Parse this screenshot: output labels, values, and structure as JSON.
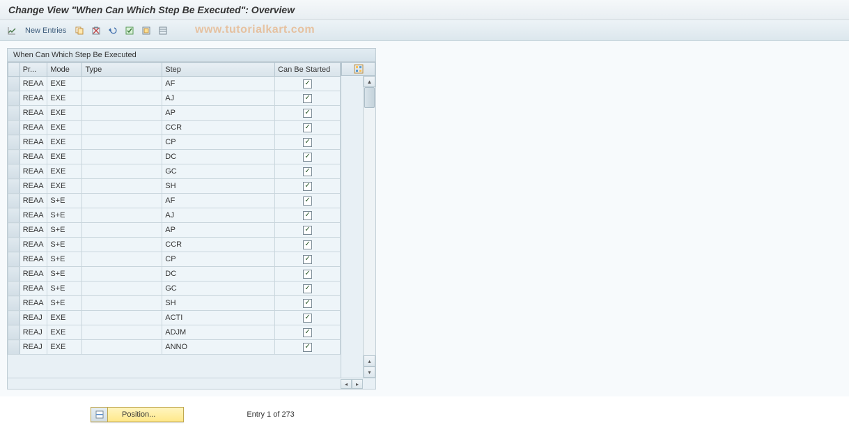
{
  "title": "Change View \"When Can Which Step Be Executed\": Overview",
  "toolbar": {
    "new_entries_label": "New Entries"
  },
  "watermark": "www.tutorialkart.com",
  "panel": {
    "header": "When Can Which Step Be Executed",
    "columns": {
      "pr": "Pr...",
      "mode": "Mode",
      "type": "Type",
      "step": "Step",
      "started": "Can Be Started"
    },
    "rows": [
      {
        "pr": "REAA",
        "mode": "EXE",
        "type": "",
        "step": "AF",
        "started": true
      },
      {
        "pr": "REAA",
        "mode": "EXE",
        "type": "",
        "step": "AJ",
        "started": true
      },
      {
        "pr": "REAA",
        "mode": "EXE",
        "type": "",
        "step": "AP",
        "started": true
      },
      {
        "pr": "REAA",
        "mode": "EXE",
        "type": "",
        "step": "CCR",
        "started": true
      },
      {
        "pr": "REAA",
        "mode": "EXE",
        "type": "",
        "step": "CP",
        "started": true
      },
      {
        "pr": "REAA",
        "mode": "EXE",
        "type": "",
        "step": "DC",
        "started": true
      },
      {
        "pr": "REAA",
        "mode": "EXE",
        "type": "",
        "step": "GC",
        "started": true
      },
      {
        "pr": "REAA",
        "mode": "EXE",
        "type": "",
        "step": "SH",
        "started": true
      },
      {
        "pr": "REAA",
        "mode": "S+E",
        "type": "",
        "step": "AF",
        "started": true
      },
      {
        "pr": "REAA",
        "mode": "S+E",
        "type": "",
        "step": "AJ",
        "started": true
      },
      {
        "pr": "REAA",
        "mode": "S+E",
        "type": "",
        "step": "AP",
        "started": true
      },
      {
        "pr": "REAA",
        "mode": "S+E",
        "type": "",
        "step": "CCR",
        "started": true
      },
      {
        "pr": "REAA",
        "mode": "S+E",
        "type": "",
        "step": "CP",
        "started": true
      },
      {
        "pr": "REAA",
        "mode": "S+E",
        "type": "",
        "step": "DC",
        "started": true
      },
      {
        "pr": "REAA",
        "mode": "S+E",
        "type": "",
        "step": "GC",
        "started": true
      },
      {
        "pr": "REAA",
        "mode": "S+E",
        "type": "",
        "step": "SH",
        "started": true
      },
      {
        "pr": "REAJ",
        "mode": "EXE",
        "type": "",
        "step": "ACTI",
        "started": true
      },
      {
        "pr": "REAJ",
        "mode": "EXE",
        "type": "",
        "step": "ADJM",
        "started": true
      },
      {
        "pr": "REAJ",
        "mode": "EXE",
        "type": "",
        "step": "ANNO",
        "started": true
      }
    ]
  },
  "footer": {
    "position_label": "Position...",
    "entry_status": "Entry 1 of 273"
  }
}
